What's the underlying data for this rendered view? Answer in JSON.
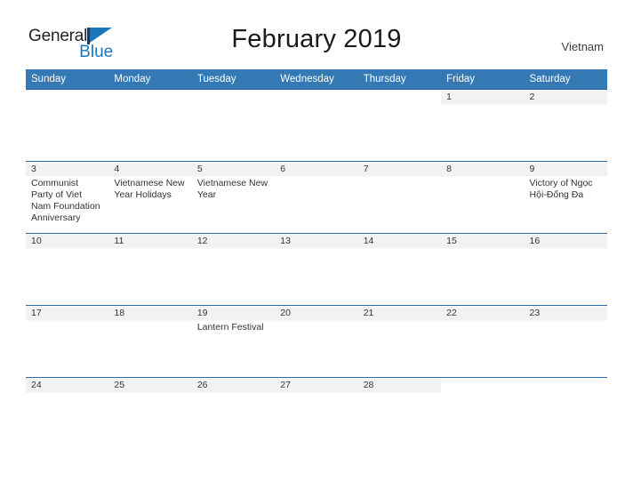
{
  "brand": {
    "word1": "General",
    "word2": "Blue",
    "flag_icon": "triangle-flag-icon",
    "accent_color": "#1b76bc"
  },
  "header": {
    "title": "February 2019",
    "country": "Vietnam"
  },
  "colors": {
    "header_blue": "#3478b4",
    "rule_blue": "#2b6ca3",
    "date_band_gray": "#f2f2f2",
    "text": "#333333"
  },
  "calendar": {
    "weekday_headers": [
      "Sunday",
      "Monday",
      "Tuesday",
      "Wednesday",
      "Thursday",
      "Friday",
      "Saturday"
    ],
    "weeks": [
      [
        {
          "date": "",
          "events": []
        },
        {
          "date": "",
          "events": []
        },
        {
          "date": "",
          "events": []
        },
        {
          "date": "",
          "events": []
        },
        {
          "date": "",
          "events": []
        },
        {
          "date": "1",
          "events": []
        },
        {
          "date": "2",
          "events": []
        }
      ],
      [
        {
          "date": "3",
          "events": [
            "Communist Party of Viet Nam Foundation Anniversary"
          ]
        },
        {
          "date": "4",
          "events": [
            "Vietnamese New Year Holidays"
          ]
        },
        {
          "date": "5",
          "events": [
            "Vietnamese New Year"
          ]
        },
        {
          "date": "6",
          "events": []
        },
        {
          "date": "7",
          "events": []
        },
        {
          "date": "8",
          "events": []
        },
        {
          "date": "9",
          "events": [
            "Victory of Ngọc Hội-Đống Đa"
          ]
        }
      ],
      [
        {
          "date": "10",
          "events": []
        },
        {
          "date": "11",
          "events": []
        },
        {
          "date": "12",
          "events": []
        },
        {
          "date": "13",
          "events": []
        },
        {
          "date": "14",
          "events": []
        },
        {
          "date": "15",
          "events": []
        },
        {
          "date": "16",
          "events": []
        }
      ],
      [
        {
          "date": "17",
          "events": []
        },
        {
          "date": "18",
          "events": []
        },
        {
          "date": "19",
          "events": [
            "Lantern Festival"
          ]
        },
        {
          "date": "20",
          "events": []
        },
        {
          "date": "21",
          "events": []
        },
        {
          "date": "22",
          "events": []
        },
        {
          "date": "23",
          "events": []
        }
      ],
      [
        {
          "date": "24",
          "events": []
        },
        {
          "date": "25",
          "events": []
        },
        {
          "date": "26",
          "events": []
        },
        {
          "date": "27",
          "events": []
        },
        {
          "date": "28",
          "events": []
        },
        {
          "date": "",
          "events": []
        },
        {
          "date": "",
          "events": []
        }
      ]
    ]
  }
}
